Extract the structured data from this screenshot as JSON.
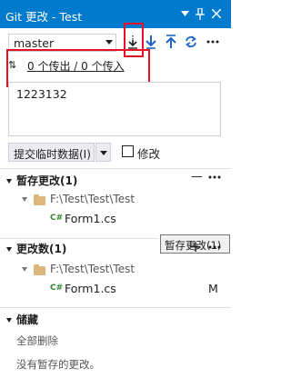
{
  "window": {
    "title": "Git 更改 - Test",
    "buttons": [
      "dropdown-icon",
      "pin-icon",
      "close-icon"
    ]
  },
  "toolbar": {
    "branch": "master",
    "tools": [
      "fetch-icon",
      "pull-icon",
      "push-icon",
      "sync-icon",
      "more-icon"
    ]
  },
  "sync": {
    "icon": "⇅",
    "status_link": "0 个传出 / 0 个传入"
  },
  "commit": {
    "message": "1223132",
    "button_label": "提交临时数据(I)",
    "amend_label": "修改"
  },
  "staged": {
    "title": "暂存更改(1)",
    "folder": "F:\\Test\\Test\\Test",
    "files": [
      {
        "name": "Form1.cs",
        "icon": "C#"
      }
    ],
    "actions": [
      "unstage-all-icon",
      "more-icon"
    ]
  },
  "changes": {
    "title": "更改数(1)",
    "folder": "F:\\Test\\Test\\Test",
    "files": [
      {
        "name": "Form1.cs",
        "icon": "C#",
        "status": "M"
      }
    ],
    "actions": [
      "stage-all-icon",
      "more-icon"
    ]
  },
  "stashes": {
    "title": "储藏",
    "delete_all": "全部删除",
    "empty_text": "没有暂存的更改。"
  },
  "tooltip": "暂存更改(1)",
  "colors": {
    "titlebar": "#007acc",
    "highlight": "#e81123",
    "accent_blue": "#1c64c7"
  }
}
